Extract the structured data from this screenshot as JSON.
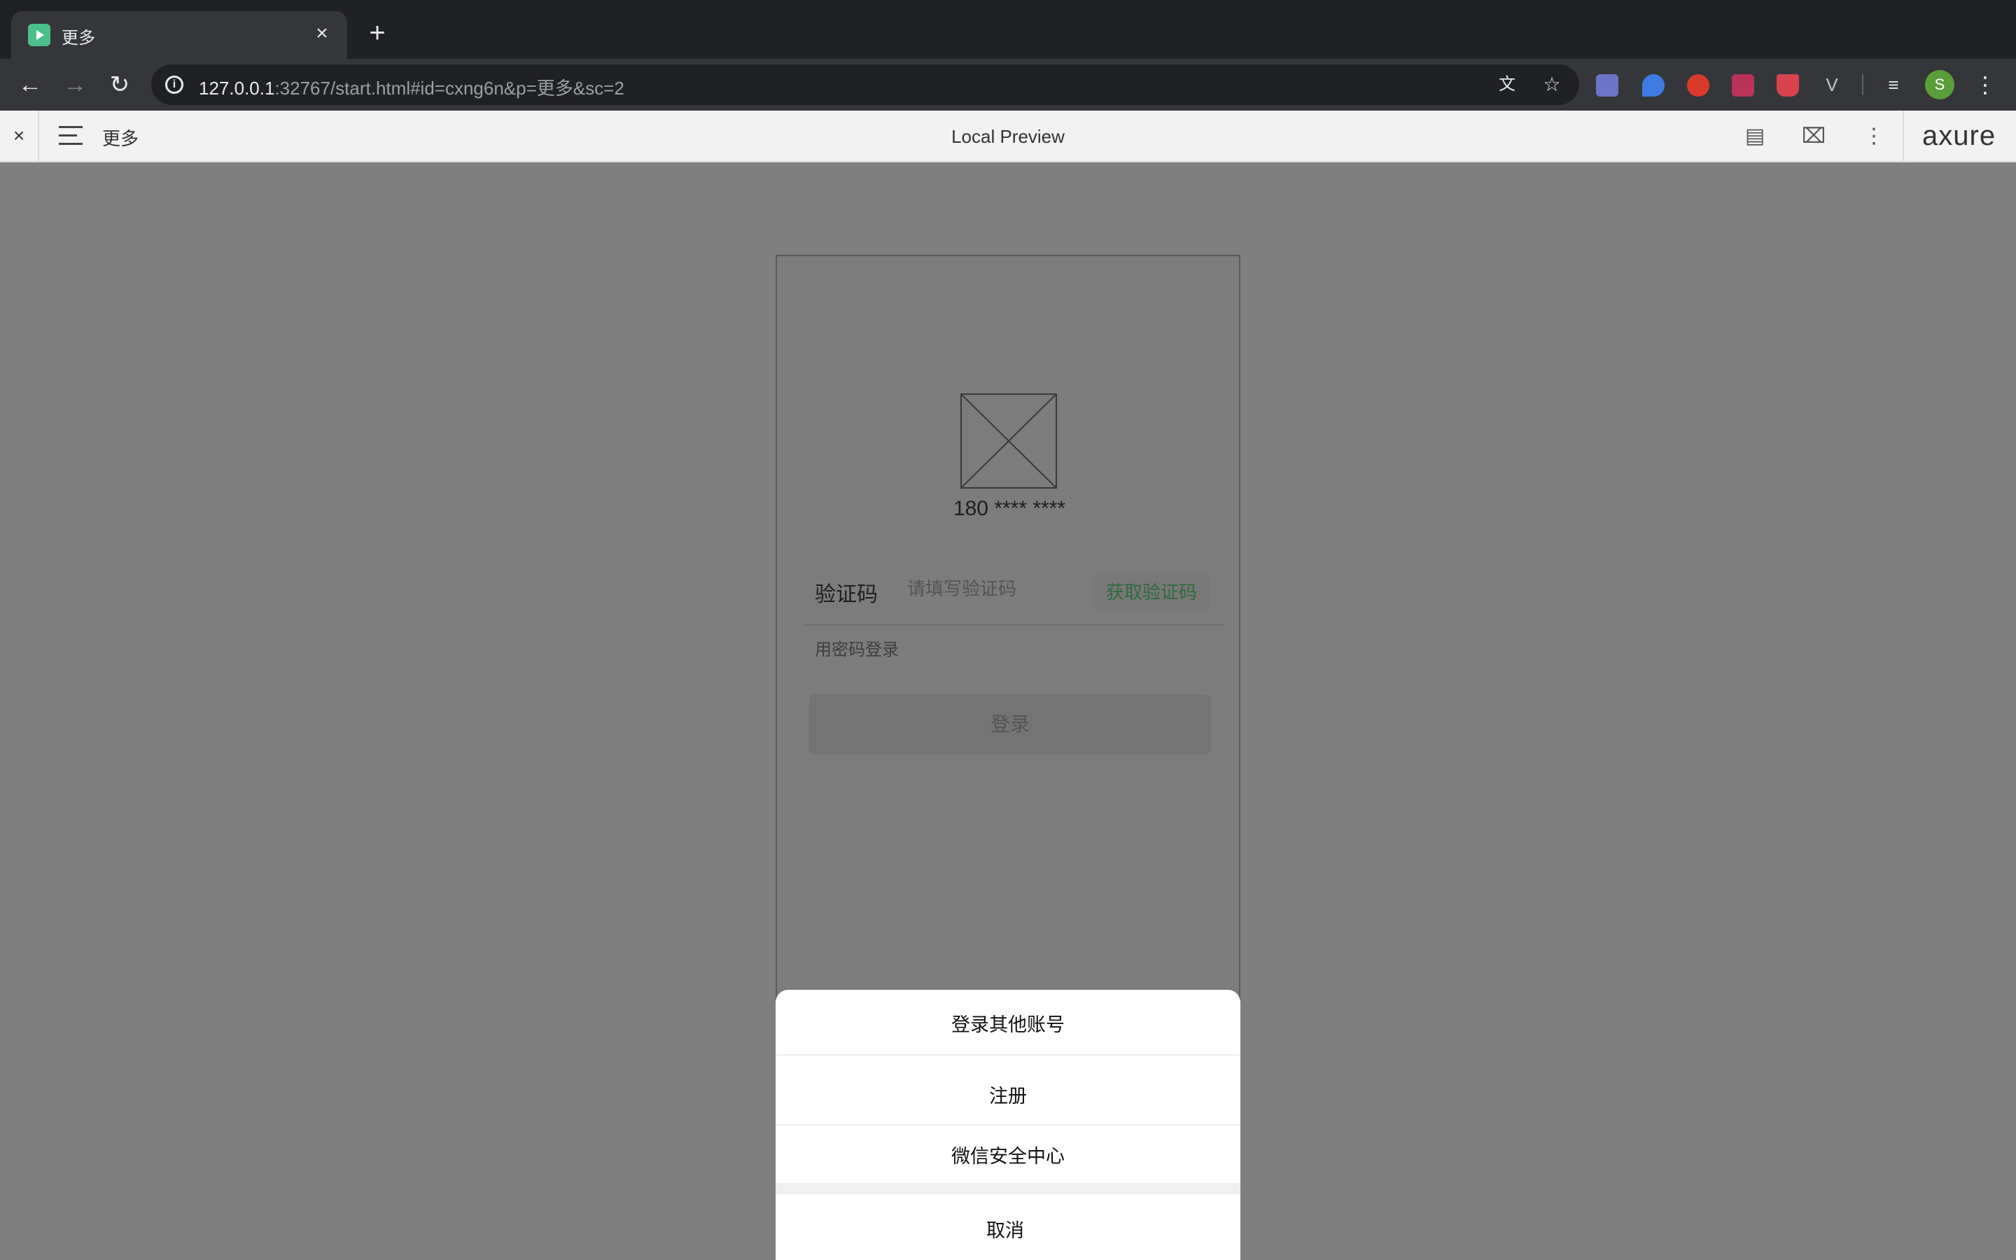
{
  "browser": {
    "tab_title": "更多",
    "url_host": "127.0.0.1",
    "url_rest": ":32767/start.html#id=cxng6n&p=更多&sc=2",
    "profile_initial": "S"
  },
  "axure": {
    "page_name": "更多",
    "preview_title": "Local Preview",
    "logo": "axure"
  },
  "login": {
    "phone_masked": "180 **** ****",
    "code_label": "验证码",
    "code_placeholder": "请填写验证码",
    "get_code": "获取验证码",
    "password_login": "用密码登录",
    "login_button": "登录"
  },
  "action_sheet": {
    "items": [
      "登录其他账号",
      "注册",
      "微信安全中心"
    ],
    "cancel": "取消"
  },
  "colors": {
    "overlay": "#7f7f7f",
    "accent_green": "#2f6c3f",
    "favicon": "#4bc08a"
  }
}
